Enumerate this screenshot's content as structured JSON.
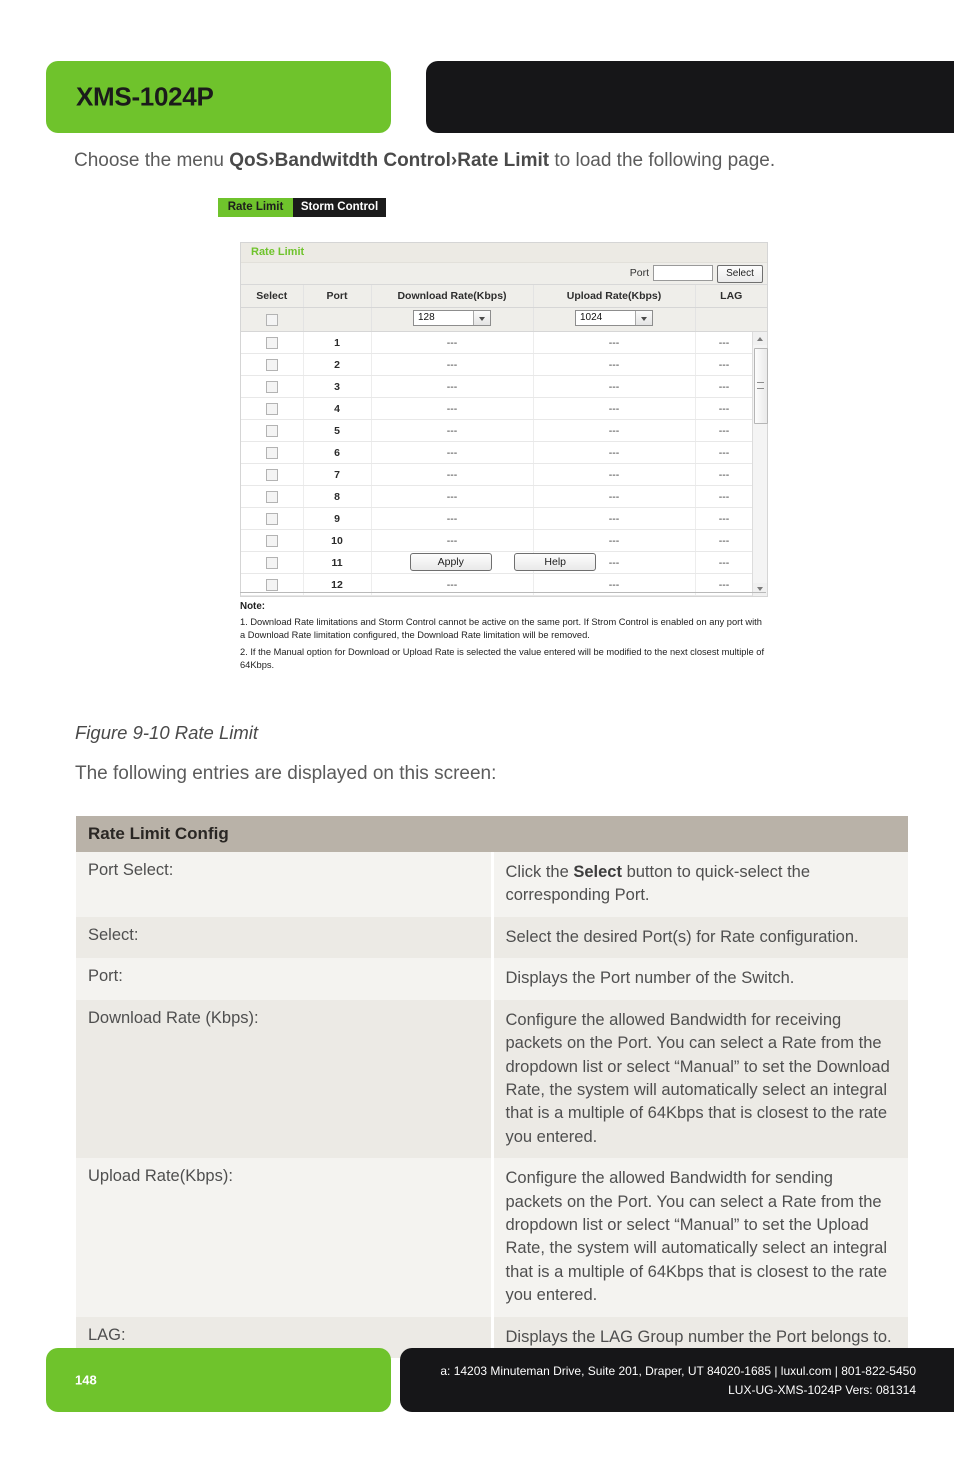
{
  "header": {
    "model_title": "XMS-1024P"
  },
  "intro": {
    "before": "Choose the menu ",
    "menu_path": "QoS›Bandwitdth Control›Rate Limit",
    "after": " to load the following page."
  },
  "screenshot": {
    "tabs": [
      {
        "label": "Rate Limit",
        "active": true
      },
      {
        "label": "Storm Control",
        "active": false
      }
    ],
    "panel_title": "Rate Limit",
    "port_label": "Port",
    "port_value": "",
    "select_button": "Select",
    "columns": [
      "Select",
      "Port",
      "Download Rate(Kbps)",
      "Upload Rate(Kbps)",
      "LAG"
    ],
    "config_row": {
      "download_rate": "128",
      "upload_rate": "1024"
    },
    "rows": [
      {
        "port": "1",
        "download": "---",
        "upload": "---",
        "lag": "---"
      },
      {
        "port": "2",
        "download": "---",
        "upload": "---",
        "lag": "---"
      },
      {
        "port": "3",
        "download": "---",
        "upload": "---",
        "lag": "---"
      },
      {
        "port": "4",
        "download": "---",
        "upload": "---",
        "lag": "---"
      },
      {
        "port": "5",
        "download": "---",
        "upload": "---",
        "lag": "---"
      },
      {
        "port": "6",
        "download": "---",
        "upload": "---",
        "lag": "---"
      },
      {
        "port": "7",
        "download": "---",
        "upload": "---",
        "lag": "---"
      },
      {
        "port": "8",
        "download": "---",
        "upload": "---",
        "lag": "---"
      },
      {
        "port": "9",
        "download": "---",
        "upload": "---",
        "lag": "---"
      },
      {
        "port": "10",
        "download": "---",
        "upload": "---",
        "lag": "---"
      },
      {
        "port": "11",
        "download": "---",
        "upload": "---",
        "lag": "---"
      },
      {
        "port": "12",
        "download": "---",
        "upload": "---",
        "lag": "---"
      }
    ],
    "buttons": {
      "apply": "Apply",
      "help": "Help"
    },
    "note": {
      "heading": "Note:",
      "item1": "1. Download Rate limitations and Storm Control cannot be active on the same port. If Strom Control is enabled on any port with a Download Rate limitation configured, the Download Rate limitation will be removed.",
      "item2": "2. If the Manual option for Download or Upload Rate is selected the value entered will be modified to the next closest multiple of 64Kbps."
    }
  },
  "figure_caption": "Figure 9-10 Rate Limit",
  "lead_in": "The following entries are displayed on this screen:",
  "desc_table": {
    "title": "Rate Limit Config",
    "rows": [
      {
        "key": "Port Select:",
        "value_pre": "Click the ",
        "value_bold": "Select",
        "value_post": " button to quick-select the corresponding Port."
      },
      {
        "key": "Select:",
        "value_pre": "Select the desired Port(s) for Rate configuration.",
        "value_bold": "",
        "value_post": ""
      },
      {
        "key": "Port:",
        "value_pre": "Displays the Port number of the Switch.",
        "value_bold": "",
        "value_post": ""
      },
      {
        "key": "Download Rate (Kbps):",
        "value_pre": "Configure the allowed Bandwidth for receiving packets on the Port. You can select a Rate from the dropdown list or select “Manual” to set the Download Rate, the system will automatically select an integral that is a multiple of 64Kbps that is closest to the rate you entered.",
        "value_bold": "",
        "value_post": ""
      },
      {
        "key": "Upload Rate(Kbps):",
        "value_pre": "Configure the allowed Bandwidth for sending packets on the Port. You can select a Rate from the dropdown list or select “Manual” to set the Upload Rate, the system will automatically select an integral that is a multiple of 64Kbps that is closest to the rate you entered.",
        "value_bold": "",
        "value_post": ""
      },
      {
        "key": "LAG:",
        "value_pre": "Displays the LAG Group number the Port belongs to.",
        "value_bold": "",
        "value_post": ""
      }
    ]
  },
  "footer": {
    "page_number": "148",
    "address_line1": "a: 14203 Minuteman Drive, Suite 201, Draper, UT 84020-1685 | luxul.com | 801-822-5450",
    "address_line2": "LUX-UG-XMS-1024P  Vers: 081314"
  },
  "colors": {
    "brand_green": "#6fc32c",
    "brand_black": "#161618",
    "table_header_tan": "#b9b2a8"
  }
}
